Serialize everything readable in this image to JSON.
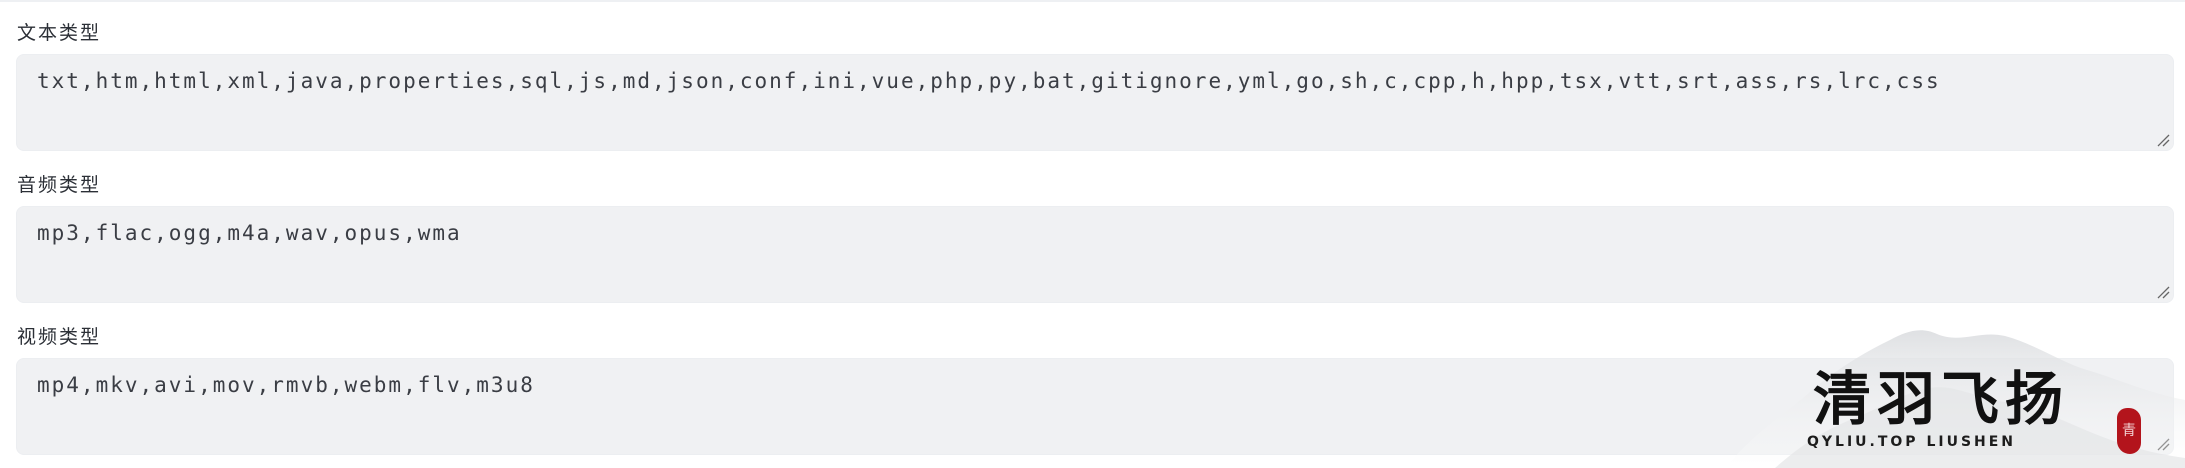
{
  "fields": [
    {
      "label": "文本类型",
      "value": "txt,htm,html,xml,java,properties,sql,js,md,json,conf,ini,vue,php,py,bat,gitignore,yml,go,sh,c,cpp,h,hpp,tsx,vtt,srt,ass,rs,lrc,css"
    },
    {
      "label": "音频类型",
      "value": "mp3,flac,ogg,m4a,wav,opus,wma"
    },
    {
      "label": "视频类型",
      "value": "mp4,mkv,avi,mov,rmvb,webm,flv,m3u8"
    }
  ],
  "watermark": {
    "title": "清羽飞扬",
    "subtitle": "QYLIU.TOP   LIUSHEN",
    "seal": "青"
  },
  "colors": {
    "field_background": "#f0f1f3",
    "label_text": "#2b2f36",
    "value_text": "#3a3d44",
    "seal": "#b3141c"
  }
}
